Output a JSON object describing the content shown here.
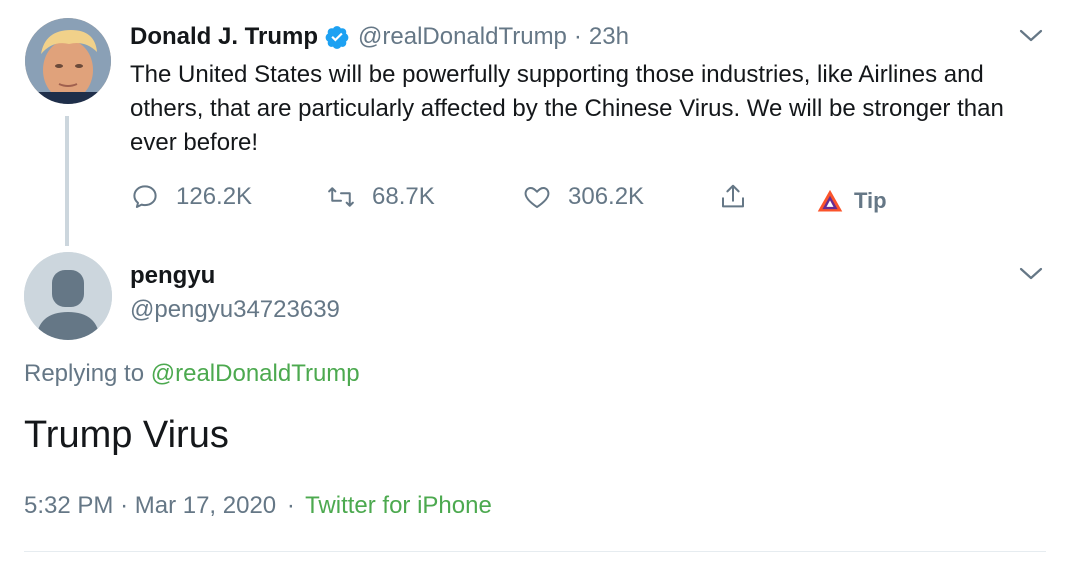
{
  "original_tweet": {
    "display_name": "Donald J. Trump",
    "handle": "@realDonaldTrump",
    "separator": "·",
    "time_ago": "23h",
    "text": "The United States will be powerfully supporting those industries, like Airlines and others, that are particularly affected by the Chinese Virus. We will be stronger than ever before!",
    "actions": {
      "reply_count": "126.2K",
      "retweet_count": "68.7K",
      "like_count": "306.2K",
      "tip_label": "Tip"
    },
    "icons": [
      "reply-icon",
      "retweet-icon",
      "like-icon",
      "share-icon",
      "brave-tip-icon",
      "verified-badge-icon",
      "chevron-down-icon"
    ]
  },
  "reply_tweet": {
    "display_name": "pengyu",
    "handle": "@pengyu34723639",
    "replying_prefix": "Replying to",
    "replying_to": "@realDonaldTrump",
    "text": "Trump Virus",
    "time": "5:32 PM",
    "separator": "·",
    "date": "Mar 17, 2020",
    "source": "Twitter for iPhone"
  },
  "colors": {
    "text_primary": "#14171a",
    "text_secondary": "#657786",
    "link": "#4ca94f",
    "verified": "#1da1f2",
    "thread_line": "#ccd6dd",
    "divider": "#e6ecf0"
  }
}
